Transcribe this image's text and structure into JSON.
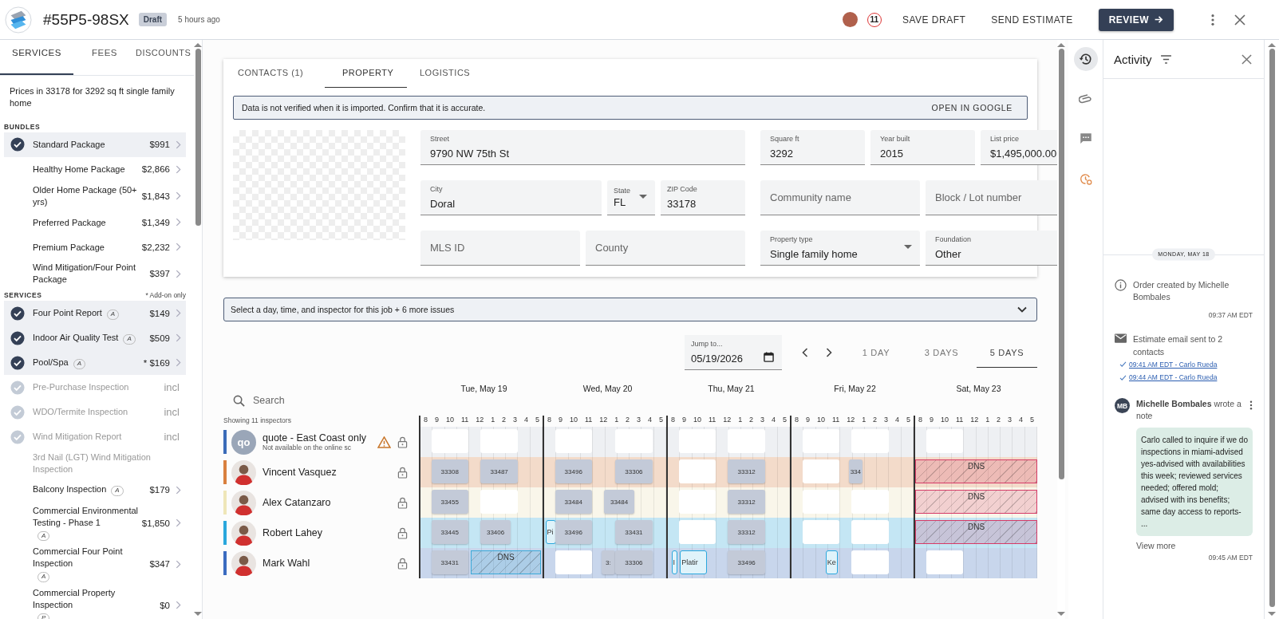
{
  "header": {
    "order_number": "#55P5-98SX",
    "status": "Draft",
    "updated": "5 hours ago",
    "count": "11",
    "buttons": [
      {
        "label": "SAVE DRAFT",
        "kind": "text"
      },
      {
        "label": "SEND ESTIMATE",
        "kind": "text"
      },
      {
        "label": "REVIEW",
        "kind": "primary"
      }
    ]
  },
  "sidebar": {
    "tabs": [
      {
        "label": "SERVICES",
        "selected": true
      },
      {
        "label": "FEES",
        "selected": false
      },
      {
        "label": "DISCOUNTS",
        "selected": false
      }
    ],
    "intro": "Prices in 33178 for 3292 sq ft single family home",
    "groups": [
      {
        "heading": "BUNDLES",
        "items": [
          {
            "name": "Standard Package",
            "price": "$991",
            "checked": true,
            "disabled": false
          },
          {
            "name": "Healthy Home Package",
            "price": "$2,866",
            "checked": false,
            "disabled": false
          },
          {
            "name": "Older Home Package (50+ yrs)",
            "price": "$1,843",
            "checked": false,
            "disabled": false
          },
          {
            "name": "Preferred Package",
            "price": "$1,349",
            "checked": false,
            "disabled": false
          },
          {
            "name": "Premium Package",
            "price": "$2,232",
            "checked": false,
            "disabled": false
          },
          {
            "name": "Wind Mitigation/Four Point Package",
            "price": "$397",
            "checked": false,
            "disabled": false
          }
        ]
      },
      {
        "heading": "SERVICES",
        "note": "* Add-on only",
        "items": [
          {
            "name": "Four Point Report",
            "badge": "A",
            "price": "$149",
            "checked": true,
            "disabled": false
          },
          {
            "name": "Indoor Air Quality Test",
            "badge": "A",
            "price": "$509",
            "checked": true,
            "disabled": false
          },
          {
            "name": "Pool/Spa",
            "badge": "A",
            "price": "* $169",
            "checked": true,
            "disabled": false
          },
          {
            "name": "Pre-Purchase Inspection",
            "price": "incl",
            "checked": true,
            "disabled": true
          },
          {
            "name": "WDO/Termite Inspection",
            "price": "incl",
            "checked": true,
            "disabled": true
          },
          {
            "name": "Wind Mitigation Report",
            "price": "incl",
            "checked": true,
            "disabled": true
          },
          {
            "name": "3rd Nail (LGT) Wind Mitigation Inspection",
            "checked": false,
            "disabled": true
          },
          {
            "name": "Balcony Inspection",
            "badge": "A",
            "price": "$179",
            "checked": false,
            "disabled": false
          },
          {
            "name": "Commercial Environmental Testing - Phase 1",
            "badge": "A",
            "price": "$1,850",
            "checked": false,
            "disabled": false
          },
          {
            "name": "Commercial Four Point Inspection",
            "badge": "A",
            "price": "$347",
            "checked": false,
            "disabled": false
          },
          {
            "name": "Commercial Property Inspection",
            "badge": "P",
            "price": "$0",
            "checked": false,
            "disabled": false
          }
        ]
      }
    ]
  },
  "property": {
    "tabs": [
      {
        "label": "CONTACTS (1)",
        "selected": false
      },
      {
        "label": "PROPERTY",
        "selected": true
      },
      {
        "label": "LOGISTICS",
        "selected": false
      }
    ],
    "notice": {
      "text": "Data is not verified when it is imported. Confirm that it is accurate.",
      "action": "OPEN IN GOOGLE"
    },
    "left_rows": [
      [
        {
          "label": "Street",
          "value": "9790 NW 75th St",
          "kind": "text"
        }
      ],
      [
        {
          "label": "City",
          "value": "Doral",
          "kind": "text"
        },
        {
          "label": "State",
          "value": "FL",
          "kind": "select"
        },
        {
          "label": "ZIP Code",
          "value": "33178",
          "kind": "text"
        }
      ],
      [
        {
          "placeholder": "MLS ID"
        },
        {
          "placeholder": "County"
        }
      ]
    ],
    "right_rows": [
      [
        {
          "label": "Square ft",
          "value": "3292",
          "kind": "text"
        },
        {
          "label": "Year built",
          "value": "2015",
          "kind": "text"
        },
        {
          "label": "List price",
          "value": "$1,495,000.00",
          "kind": "text"
        }
      ],
      [
        {
          "placeholder": "Community name"
        },
        {
          "placeholder": "Block / Lot number"
        }
      ],
      [
        {
          "label": "Property type",
          "value": "Single family home",
          "kind": "select"
        },
        {
          "label": "Foundation",
          "value": "Other",
          "kind": "select"
        }
      ]
    ]
  },
  "issues": "Select a day, time, and inspector for this job + 6 more issues",
  "schedule": {
    "jump": {
      "label": "Jump to...",
      "value": "05/19/2026"
    },
    "views": [
      {
        "label": "1 DAY",
        "selected": false
      },
      {
        "label": "3 DAYS",
        "selected": false
      },
      {
        "label": "5 DAYS",
        "selected": true
      }
    ],
    "search": {
      "placeholder": "Search"
    },
    "count": "Showing 11 inspectors",
    "days": [
      {
        "label": "Tue, May 19",
        "hours": "8 9 10 11 12 1 2 3 4 5"
      },
      {
        "label": "Wed, May 20",
        "hours": "8 9 10 11 12 1 2 3 4 5"
      },
      {
        "label": "Thu, May 21",
        "hours": "8 9 10 11 12 1 2 3 4 5"
      },
      {
        "label": "Fri, May 22",
        "hours": "8 9 10 11 12 1 2 3 4 5"
      },
      {
        "label": "Sat, May 23",
        "hours": "8 9 10 11 12 1 2 3 4 5"
      }
    ],
    "rows": [
      {
        "name": "quote - East Coast only",
        "subtitle": "Not available on the online sc",
        "kind": "initials",
        "initials": "qo",
        "color": "#3b6bb8",
        "available": false,
        "warning": true,
        "days": [
          [
            {
              "kind": "open-am"
            },
            {
              "kind": "open-pm"
            }
          ],
          [
            {
              "kind": "open-am"
            },
            {
              "kind": "open-late"
            }
          ],
          [
            {
              "kind": "open-am"
            },
            {
              "kind": "open-pm"
            }
          ],
          [
            {
              "kind": "open-am"
            },
            {
              "kind": "open-pm"
            }
          ],
          [
            {
              "kind": "open-am"
            }
          ]
        ]
      },
      {
        "name": "Vincent Vasquez",
        "kind": "person",
        "color": "#d9803f",
        "available": true,
        "warning": false,
        "days": [
          [
            {
              "kind": "booked-am",
              "label": "33308"
            },
            {
              "kind": "booked-pm",
              "label": "33487"
            }
          ],
          [
            {
              "kind": "booked-am",
              "label": "33496"
            },
            {
              "kind": "booked-late",
              "label": "33306"
            }
          ],
          [
            {
              "kind": "open-am"
            },
            {
              "kind": "booked-pm",
              "label": "33312"
            }
          ],
          [
            {
              "kind": "open-am"
            },
            {
              "kind": "booked-noon",
              "label": "334"
            }
          ],
          [
            {
              "kind": "dns-full",
              "label": "DNS",
              "color": "#d63b67"
            }
          ]
        ]
      },
      {
        "name": "Alex Catanzaro",
        "kind": "person",
        "color": "#efe6b8",
        "available": true,
        "warning": false,
        "days": [
          [
            {
              "kind": "booked-am",
              "label": "33455"
            },
            {
              "kind": "open-pm"
            }
          ],
          [
            {
              "kind": "booked-am",
              "label": "33484"
            },
            {
              "kind": "booked-mid",
              "label": "33484"
            }
          ],
          [
            {
              "kind": "open-am"
            },
            {
              "kind": "booked-pm",
              "label": "33312"
            }
          ],
          [
            {
              "kind": "open-am"
            },
            {
              "kind": "open-pm"
            }
          ],
          [
            {
              "kind": "dns-full",
              "label": "DNS",
              "color": "#d63b67"
            }
          ]
        ]
      },
      {
        "name": "Robert Lahey",
        "kind": "person",
        "color": "#2aa7dd",
        "available": true,
        "warning": false,
        "days": [
          [
            {
              "kind": "booked-am",
              "label": "33445"
            },
            {
              "kind": "booked-mid",
              "label": "33406"
            }
          ],
          [
            {
              "kind": "event-start",
              "label": "Pi"
            },
            {
              "kind": "booked-am",
              "label": "33496"
            },
            {
              "kind": "booked-late",
              "label": "33431"
            }
          ],
          [
            {
              "kind": "open-am"
            },
            {
              "kind": "booked-pm",
              "label": "33312"
            }
          ],
          [
            {
              "kind": "open-am"
            },
            {
              "kind": "open-pm"
            }
          ],
          [
            {
              "kind": "dns-full",
              "label": "DNS",
              "color": "#d63b67"
            }
          ]
        ]
      },
      {
        "name": "Mark Wahl",
        "kind": "person",
        "color": "#3a6bc0",
        "available": true,
        "warning": false,
        "days": [
          [
            {
              "kind": "booked-am",
              "label": "33431"
            },
            {
              "kind": "dns-afternoon",
              "label": "DNS",
              "color": "#3aa9d8"
            }
          ],
          [
            {
              "kind": "open-am"
            },
            {
              "kind": "booked-noon",
              "label": "3:"
            },
            {
              "kind": "booked-late",
              "label": "33306"
            }
          ],
          [
            {
              "kind": "event-sliver",
              "label": "I"
            },
            {
              "kind": "event-short",
              "label": "Platir"
            },
            {
              "kind": "booked-pm",
              "label": "33496"
            }
          ],
          [
            {
              "kind": "event-eleven",
              "label": "Ke"
            },
            {
              "kind": "open-pm"
            }
          ],
          [
            {
              "kind": "open-am"
            }
          ]
        ]
      }
    ]
  },
  "rail": [
    {
      "kind": "history",
      "selected": true
    },
    {
      "kind": "clip",
      "selected": false
    },
    {
      "kind": "chat",
      "selected": false
    },
    {
      "kind": "automation",
      "selected": false
    }
  ],
  "activity": {
    "title": "Activity",
    "date": "MONDAY, MAY 18",
    "events": [
      {
        "kind": "info",
        "text": "Order created by Michelle Bombales",
        "time": "09:37 AM EDT"
      },
      {
        "kind": "email",
        "text": "Estimate email sent to 2 contacts",
        "links": [
          "09:41 AM EDT - Carlo Rueda",
          "09:44 AM EDT - Carlo Rueda"
        ]
      },
      {
        "kind": "note",
        "initials": "MB",
        "text": "**Michelle Bombales** wrote a note",
        "body": "Carlo called to inquire if we do inspections in miami-advised yes-advised with availabilities this week; reviewed services needed; offered mold; advised with ins benefits; same day access to reports- ...",
        "more": "View more",
        "time": "09:45 AM EDT"
      }
    ]
  }
}
